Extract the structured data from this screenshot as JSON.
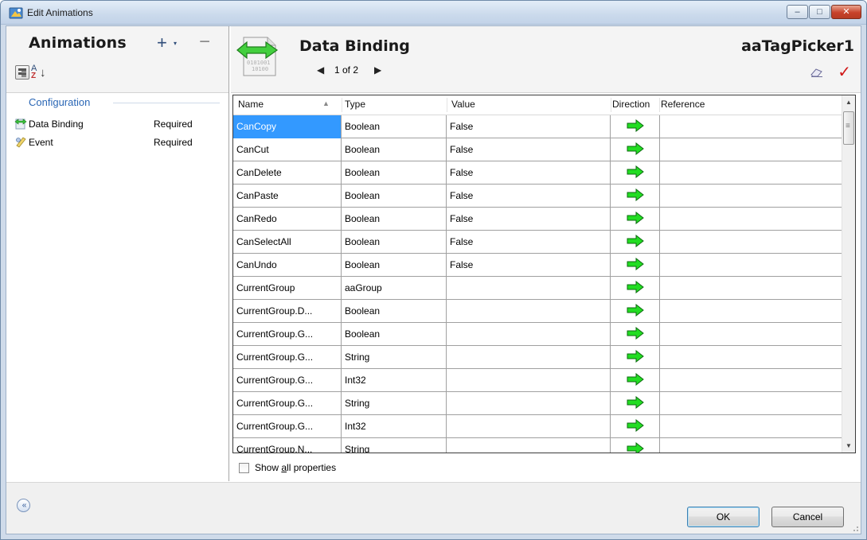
{
  "window": {
    "title": "Edit Animations",
    "buttons": {
      "minimize": "–",
      "maximize": "□",
      "close": "✕"
    }
  },
  "left_panel": {
    "title": "Animations",
    "add_label": "+",
    "add_dropdown": "▾",
    "remove_label": "−",
    "section_title": "Configuration",
    "items": [
      {
        "name": "Data Binding",
        "status": "Required",
        "icon": "data-binding-icon"
      },
      {
        "name": "Event",
        "status": "Required",
        "icon": "event-icon"
      }
    ]
  },
  "right_panel": {
    "title": "Data Binding",
    "pager": {
      "prev": "◀",
      "text": "1 of 2",
      "next": "▶"
    },
    "object_name": "aaTagPicker1",
    "icon_binary_text": [
      "0101001",
      "10100"
    ]
  },
  "grid": {
    "columns": [
      "Name",
      "Type",
      "Value",
      "Direction",
      "Reference"
    ],
    "sort_indicator": "▲",
    "rows": [
      {
        "name": "CanCopy",
        "type": "Boolean",
        "value": "False",
        "ref": "",
        "selected": true
      },
      {
        "name": "CanCut",
        "type": "Boolean",
        "value": "False",
        "ref": ""
      },
      {
        "name": "CanDelete",
        "type": "Boolean",
        "value": "False",
        "ref": ""
      },
      {
        "name": "CanPaste",
        "type": "Boolean",
        "value": "False",
        "ref": ""
      },
      {
        "name": "CanRedo",
        "type": "Boolean",
        "value": "False",
        "ref": ""
      },
      {
        "name": "CanSelectAll",
        "type": "Boolean",
        "value": "False",
        "ref": ""
      },
      {
        "name": "CanUndo",
        "type": "Boolean",
        "value": "False",
        "ref": ""
      },
      {
        "name": "CurrentGroup",
        "type": "aaGroup",
        "value": "",
        "ref": ""
      },
      {
        "name": "CurrentGroup.D...",
        "type": "Boolean",
        "value": "",
        "ref": ""
      },
      {
        "name": "CurrentGroup.G...",
        "type": "Boolean",
        "value": "",
        "ref": ""
      },
      {
        "name": "CurrentGroup.G...",
        "type": "String",
        "value": "",
        "ref": ""
      },
      {
        "name": "CurrentGroup.G...",
        "type": "Int32",
        "value": "",
        "ref": ""
      },
      {
        "name": "CurrentGroup.G...",
        "type": "String",
        "value": "",
        "ref": ""
      },
      {
        "name": "CurrentGroup.G...",
        "type": "Int32",
        "value": "",
        "ref": ""
      },
      {
        "name": "CurrentGroup.N...",
        "type": "String",
        "value": "",
        "ref": ""
      }
    ],
    "direction_color": "#22dd22",
    "selected_color": "#3399ff"
  },
  "show_all": {
    "prefix": "Show ",
    "accel": "a",
    "suffix": "ll properties",
    "checked": false
  },
  "footer": {
    "collapse_label": "«",
    "ok_label": "OK",
    "cancel_label": "Cancel"
  }
}
